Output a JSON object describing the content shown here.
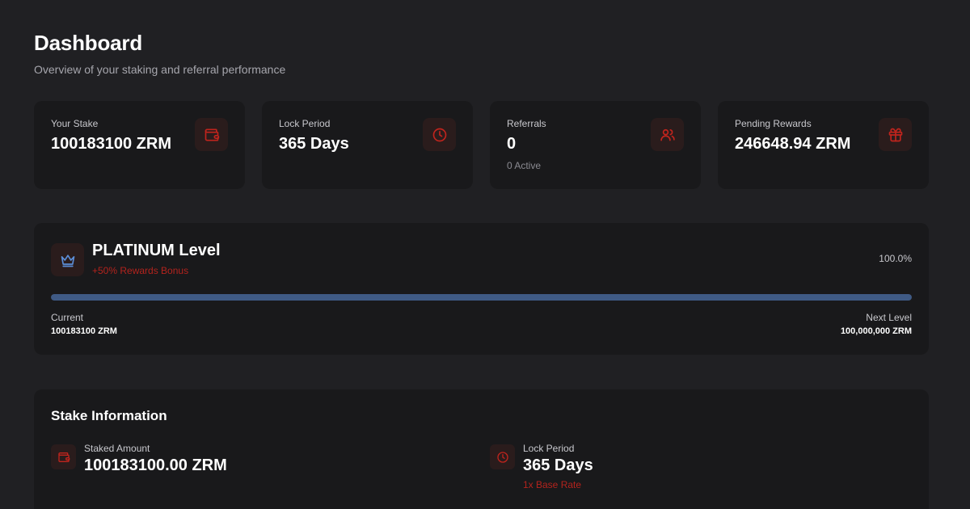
{
  "header": {
    "title": "Dashboard",
    "subtitle": "Overview of your staking and referral performance"
  },
  "stats": [
    {
      "label": "Your Stake",
      "value": "100183100 ZRM",
      "icon": "wallet-icon"
    },
    {
      "label": "Lock Period",
      "value": "365 Days",
      "icon": "clock-icon"
    },
    {
      "label": "Referrals",
      "value": "0",
      "sub": "0 Active",
      "icon": "users-icon"
    },
    {
      "label": "Pending Rewards",
      "value": "246648.94 ZRM",
      "icon": "gift-icon"
    }
  ],
  "level": {
    "title": "PLATINUM Level",
    "bonus": "+50% Rewards Bonus",
    "percent_label": "100.0%",
    "progress": 1.0,
    "current_label": "Current",
    "current_value": "100183100 ZRM",
    "next_label": "Next Level",
    "next_value": "100,000,000 ZRM",
    "icon": "crown-icon"
  },
  "stake_info": {
    "title": "Stake Information",
    "items": [
      {
        "label": "Staked Amount",
        "value": "100183100.00 ZRM",
        "icon": "wallet-icon"
      },
      {
        "label": "Lock Period",
        "value": "365 Days",
        "sub": "1x Base Rate",
        "icon": "clock-icon"
      }
    ]
  },
  "colors": {
    "background": "#202023",
    "card": "#19191b",
    "accent_red": "#b3231d",
    "icon_bg": "#2a1c1c",
    "progress_fill": "#3f5a85",
    "crown_blue": "#5b8dd6"
  }
}
